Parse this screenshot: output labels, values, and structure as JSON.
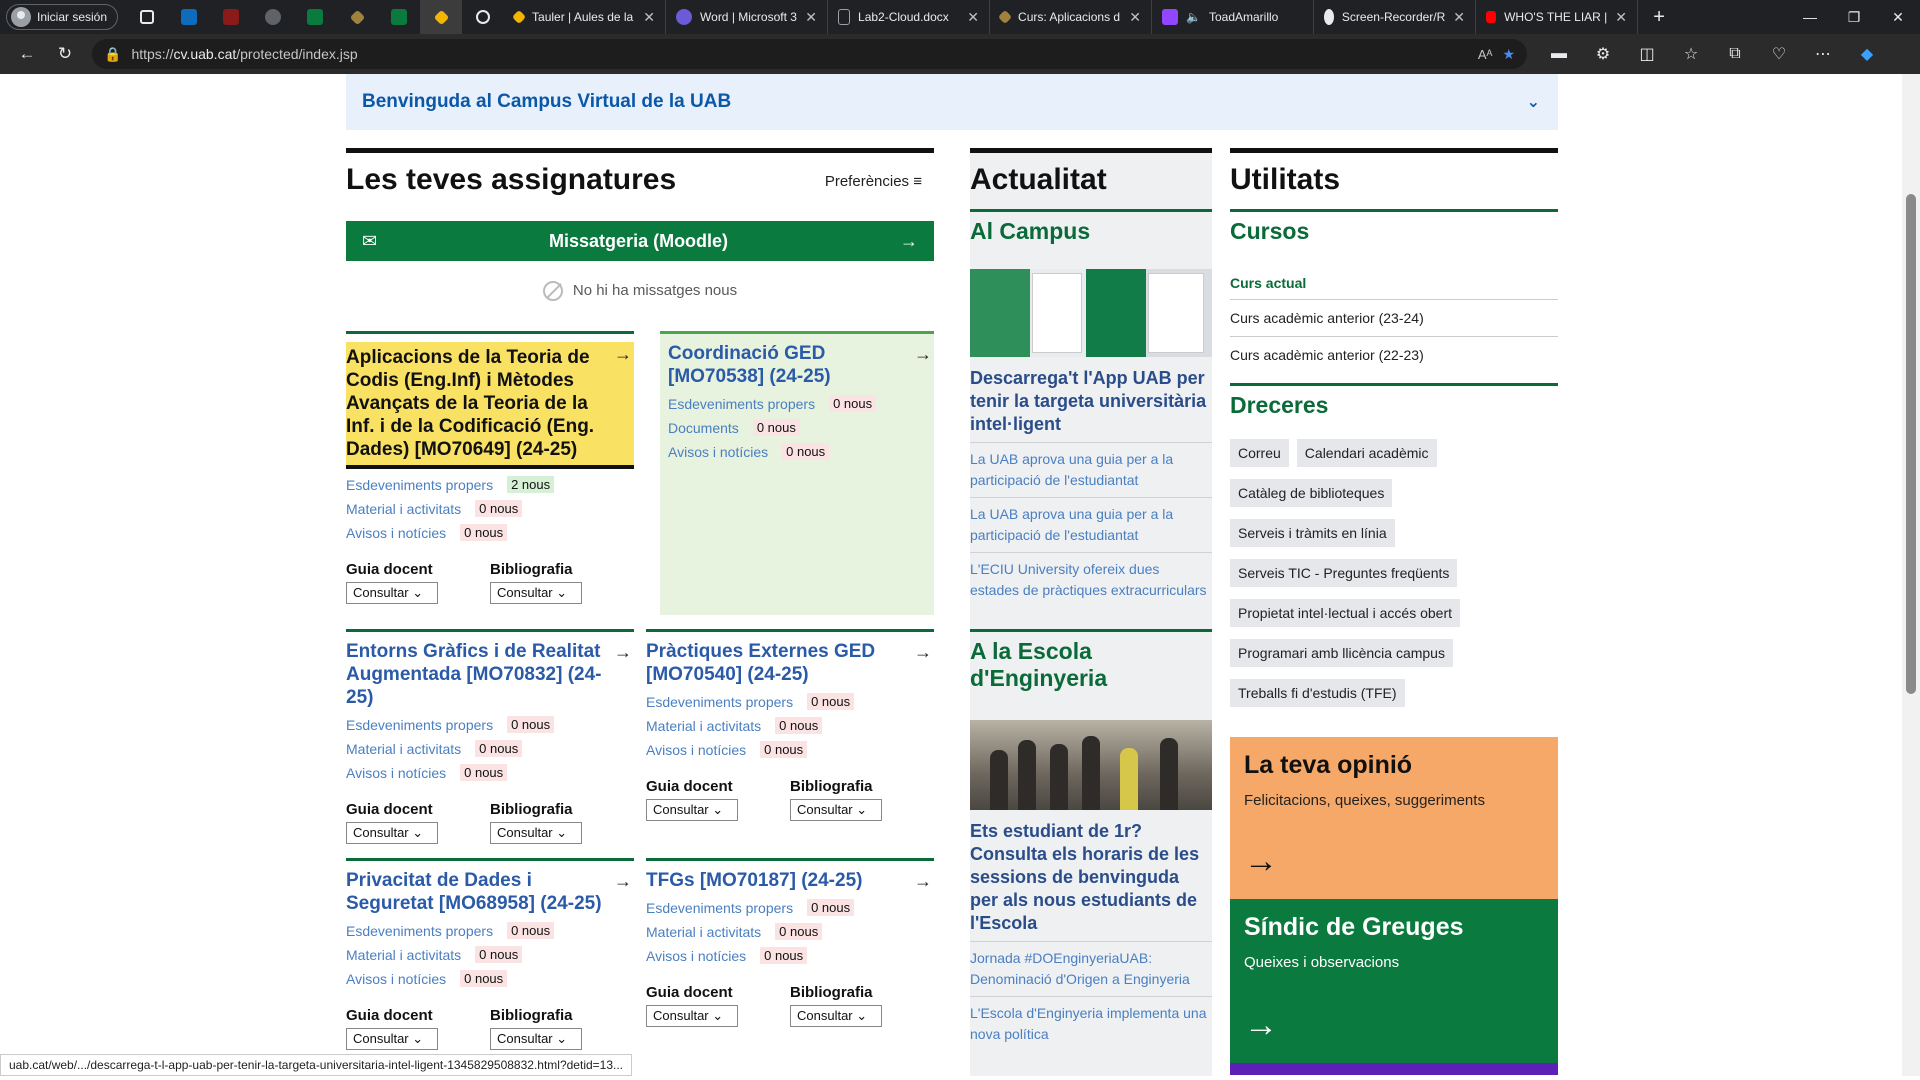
{
  "browser": {
    "profile_label": "Iniciar sesión",
    "tabs": [
      {
        "title": "Tauler | Aules de la",
        "color": "#f4b400"
      },
      {
        "title": "Word | Microsoft 3",
        "color": "#6b5bd6"
      },
      {
        "title": "Lab2-Cloud.docx",
        "color": "#9aa0a6"
      },
      {
        "title": "Curs: Aplicacions d",
        "color": "#f4b400"
      },
      {
        "title": "ToadAmarillo",
        "color": "#9146ff"
      },
      {
        "title": "Screen-Recorder/R",
        "color": "#e8eaed"
      },
      {
        "title": "WHO'S THE LIAR |",
        "color": "#ff0000"
      }
    ],
    "url_prefix": "https://",
    "url_host": "cv.uab.cat",
    "url_path": "/protected/index.jsp",
    "status_url": "uab.cat/web/.../descarrega-t-l-app-uab-per-tenir-la-targeta-universitaria-intel-ligent-1345829508832.html?detid=13..."
  },
  "welcome": "Benvinguda al Campus Virtual de la UAB",
  "subjects": {
    "title": "Les teves assignatures",
    "prefs": "Preferències",
    "msg_bar": "Missatgeria (Moodle)",
    "no_msgs": "No hi ha missatges nous",
    "guia": "Guia docent",
    "biblio": "Bibliografia",
    "consultar": "Consultar",
    "cards": [
      {
        "title": "Aplicacions de la Teoria de Codis (Eng.Inf) i Mètodes Avançats de la Teoria de la Inf. i de la Codificació (Eng. Dades) [MO70649] (24-25)",
        "rows": [
          [
            "Esdeveniments propers",
            "2 nous"
          ],
          [
            "Material i activitats",
            "0 nous"
          ],
          [
            "Avisos i notícies",
            "0 nous"
          ]
        ]
      },
      {
        "title": "Coordinació GED [MO70538] (24-25)",
        "rows": [
          [
            "Esdeveniments propers",
            "0 nous"
          ],
          [
            "Documents",
            "0 nous"
          ],
          [
            "Avisos i notícies",
            "0 nous"
          ]
        ]
      },
      {
        "title": "Entorns Gràfics i de Realitat Augmentada [MO70832] (24-25)",
        "rows": [
          [
            "Esdeveniments propers",
            "0 nous"
          ],
          [
            "Material i activitats",
            "0 nous"
          ],
          [
            "Avisos i notícies",
            "0 nous"
          ]
        ]
      },
      {
        "title": "Pràctiques Externes GED [MO70540] (24-25)",
        "rows": [
          [
            "Esdeveniments propers",
            "0 nous"
          ],
          [
            "Material i activitats",
            "0 nous"
          ],
          [
            "Avisos i notícies",
            "0 nous"
          ]
        ]
      },
      {
        "title": "Privacitat de Dades i Seguretat [MO68958] (24-25)",
        "rows": [
          [
            "Esdeveniments propers",
            "0 nous"
          ],
          [
            "Material i activitats",
            "0 nous"
          ],
          [
            "Avisos i notícies",
            "0 nous"
          ]
        ]
      },
      {
        "title": "TFGs [MO70187] (24-25)",
        "rows": [
          [
            "Esdeveniments propers",
            "0 nous"
          ],
          [
            "Material i activitats",
            "0 nous"
          ],
          [
            "Avisos i notícies",
            "0 nous"
          ]
        ]
      }
    ]
  },
  "news": {
    "title": "Actualitat",
    "campus_h": "Al Campus",
    "campus_headline": "Descarrega't l'App UAB per tenir la targeta universitària intel·ligent",
    "campus_items": [
      "La UAB aprova una guia per a la participació de l'estudiantat",
      "La UAB aprova una guia per a la participació de l'estudiantat",
      "L'ECIU University ofereix dues estades de pràctiques extracurriculars"
    ],
    "escola_h": "A la Escola d'Enginyeria",
    "escola_headline": "Ets estudiant de 1r? Consulta els horaris de les sessions de benvinguda per als nous estudiants de l'Escola",
    "escola_items": [
      "Jornada #DOEnginyeriaUAB: Denominació d'Origen a Enginyeria",
      "L'Escola d'Enginyeria implementa una nova política"
    ]
  },
  "utils": {
    "title": "Utilitats",
    "cursos_h": "Cursos",
    "curs_actual": "Curs actual",
    "curs_ant1": "Curs acadèmic anterior (23-24)",
    "curs_ant2": "Curs acadèmic anterior (22-23)",
    "dreceres_h": "Dreceres",
    "chips": [
      "Correu",
      "Calendari acadèmic",
      "Catàleg de biblioteques",
      "Serveis i tràmits en línia",
      "Serveis TIC - Preguntes freqüents",
      "Propietat intel·lectual i accés obert",
      "Programari amb llicència campus",
      "Treballs fi d'estudis (TFE)"
    ],
    "opinio_h": "La teva opinió",
    "opinio_s": "Felicitacions, queixes, suggeriments",
    "sindic_h": "Síndic de Greuges",
    "sindic_s": "Queixes i observacions"
  },
  "colors": {
    "uab_green": "#0a7a3e",
    "highlight": "#f9e163",
    "link_blue": "#2a5aa8",
    "opinion_orange": "#f6a868"
  }
}
